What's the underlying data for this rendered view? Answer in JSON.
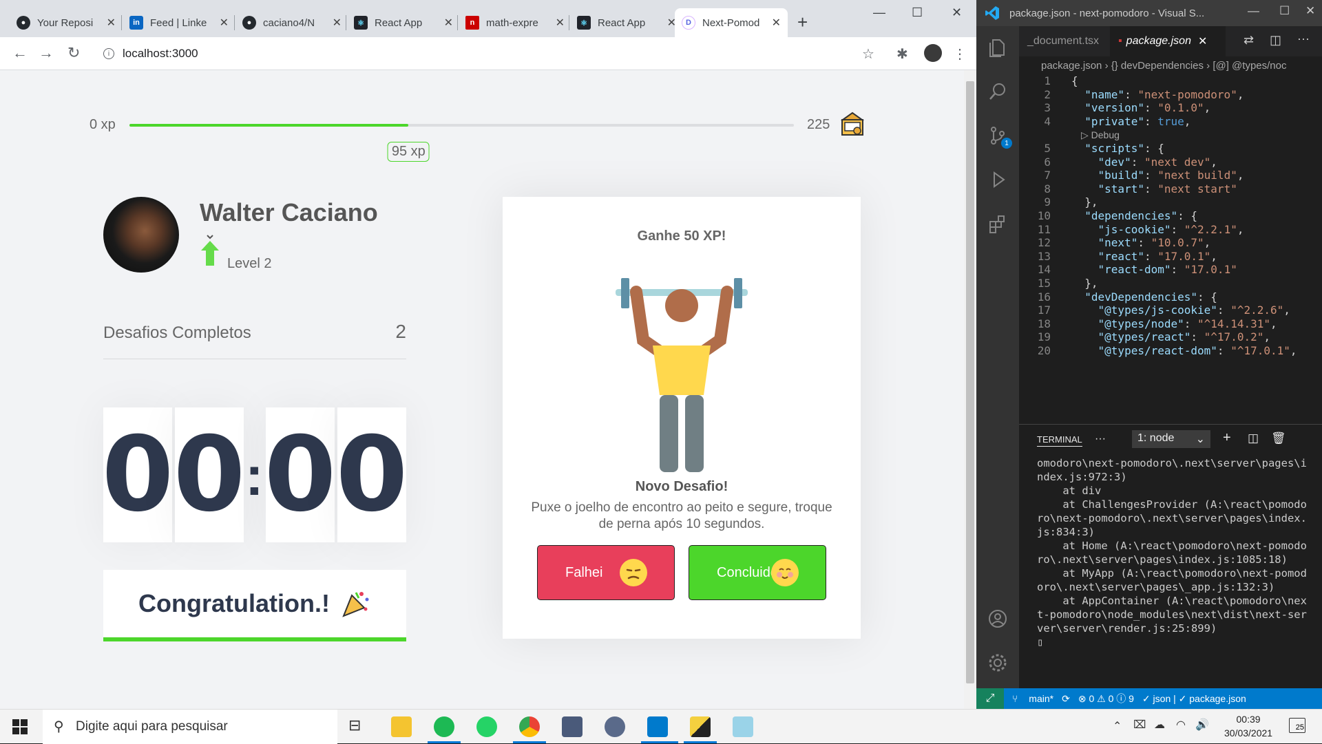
{
  "browser": {
    "tabs": [
      {
        "label": "Your Reposi",
        "icon": "github-icon"
      },
      {
        "label": "Feed | Linke",
        "icon": "linkedin-icon"
      },
      {
        "label": "caciano4/N",
        "icon": "github-icon"
      },
      {
        "label": "React App",
        "icon": "react-icon"
      },
      {
        "label": "math-expre",
        "icon": "npm-icon"
      },
      {
        "label": "React App",
        "icon": "react-icon"
      },
      {
        "label": "Next-Pomod",
        "icon": "pomodoro-icon"
      }
    ],
    "url": "localhost:3000"
  },
  "app": {
    "xp": {
      "min_label": "0 xp",
      "max_label": "225",
      "current_label": "95 xp",
      "progress": 0.42
    },
    "profile": {
      "name": "Walter Caciano",
      "level": "Level 2"
    },
    "completed": {
      "label": "Desafios Completos",
      "value": "2"
    },
    "countdown": {
      "m1": "0",
      "m2": "0",
      "sep": ":",
      "s1": "0",
      "s2": "0"
    },
    "cycle_button": {
      "label": "Congratulation.!"
    },
    "challenge": {
      "header": "Ganhe 50 XP!",
      "title": "Novo Desafio!",
      "description": "Puxe o joelho de encontro ao peito e segure, troque de perna após 10 segundos.",
      "fail_label": "Falhei",
      "done_label": "Concluido"
    },
    "colors": {
      "green": "#4cd62b",
      "red": "#e83f5b",
      "dark": "#2e384d"
    }
  },
  "vscode": {
    "title": "package.json - next-pomodoro - Visual S...",
    "tabs": [
      "_document.tsx",
      "package.json"
    ],
    "breadcrumb": "package.json › {} devDependencies › [@] @types/noc",
    "debug_label": "▷ Debug",
    "lines": [
      {
        "n": "1",
        "t": "{"
      },
      {
        "n": "2",
        "t": "  \"name\": \"next-pomodoro\","
      },
      {
        "n": "3",
        "t": "  \"version\": \"0.1.0\","
      },
      {
        "n": "4",
        "t": "  \"private\": true,"
      },
      {
        "n": "5",
        "t": "  \"scripts\": {"
      },
      {
        "n": "6",
        "t": "    \"dev\": \"next dev\","
      },
      {
        "n": "7",
        "t": "    \"build\": \"next build\","
      },
      {
        "n": "8",
        "t": "    \"start\": \"next start\""
      },
      {
        "n": "9",
        "t": "  },"
      },
      {
        "n": "10",
        "t": "  \"dependencies\": {"
      },
      {
        "n": "11",
        "t": "    \"js-cookie\": \"^2.2.1\","
      },
      {
        "n": "12",
        "t": "    \"next\": \"10.0.7\","
      },
      {
        "n": "13",
        "t": "    \"react\": \"17.0.1\","
      },
      {
        "n": "14",
        "t": "    \"react-dom\": \"17.0.1\""
      },
      {
        "n": "15",
        "t": "  },"
      },
      {
        "n": "16",
        "t": "  \"devDependencies\": {"
      },
      {
        "n": "17",
        "t": "    \"@types/js-cookie\": \"^2.2.6\","
      },
      {
        "n": "18",
        "t": "    \"@types/node\": \"^14.14.31\","
      },
      {
        "n": "19",
        "t": "    \"@types/react\": \"^17.0.2\","
      },
      {
        "n": "20",
        "t": "    \"@types/react-dom\": \"^17.0.1\","
      }
    ],
    "terminal": {
      "tab": "TERMINAL",
      "more": "···",
      "selected": "1: node",
      "output": "omodoro\\next-pomodoro\\.next\\server\\pages\\index.js:972:3)\n    at div\n    at ChallengesProvider (A:\\react\\pomodoro\\next-pomodoro\\.next\\server\\pages\\index.js:834:3)\n    at Home (A:\\react\\pomodoro\\next-pomodoro\\.next\\server\\pages\\index.js:1085:18)\n    at MyApp (A:\\react\\pomodoro\\next-pomodoro\\.next\\server\\pages\\_app.js:132:3)\n    at AppContainer (A:\\react\\pomodoro\\next-pomodoro\\node_modules\\next\\dist\\next-server\\server\\render.js:25:899)\n▯"
    },
    "status": {
      "branch": "main*",
      "problems": "⊗ 0 ⚠ 0 ⓘ 9",
      "lang": "✓ json | ✓ package.json"
    },
    "activity_badge": "1"
  },
  "taskbar": {
    "search_placeholder": "Digite aqui para pesquisar",
    "time": "00:39",
    "date": "30/03/2021",
    "notifications": "25"
  }
}
